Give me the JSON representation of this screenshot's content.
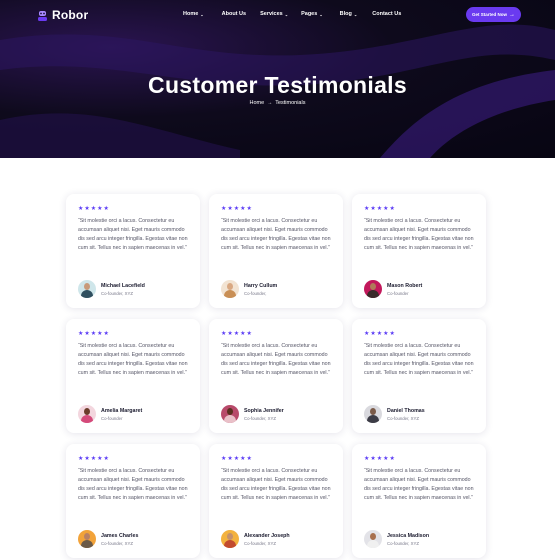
{
  "header": {
    "logo_text": "Robor",
    "nav": [
      {
        "label": "Home",
        "has_dropdown": true
      },
      {
        "label": "About Us",
        "has_dropdown": false
      },
      {
        "label": "Services",
        "has_dropdown": true
      },
      {
        "label": "Pages",
        "has_dropdown": true
      },
      {
        "label": "Blog",
        "has_dropdown": true
      },
      {
        "label": "Contact Us",
        "has_dropdown": false
      }
    ],
    "cta_label": "Get Started Now",
    "cta_icon": "arrow-right-icon"
  },
  "hero": {
    "title": "Customer Testimonials",
    "breadcrumb_home": "Home",
    "breadcrumb_current": "Testimonials"
  },
  "colors": {
    "accent": "#5b3cf5",
    "cta": "#6a3af0",
    "hero_bg": "#0e0a1c"
  },
  "testimonials": [
    {
      "stars": "★★★★★",
      "quote": "“Sit molestie orci a lacus. Consectetur eu accumsan aliquet nisi. Eget mauris commodo dis sed arcu integer fringilla. Egestas vitae non cum sit. Tellus nec in sapien maecenas in vel.”",
      "name": "Michael Lacefield",
      "role": "Co-founder, XYZ"
    },
    {
      "stars": "★★★★★",
      "quote": "“Sit molestie orci a lacus. Consectetur eu accumsan aliquet nisi. Eget mauris commodo dis sed arcu integer fringilla. Egestas vitae non cum sit. Tellus nec in sapien maecenas in vel.”",
      "name": "Harry Cullum",
      "role": "Co-founder,"
    },
    {
      "stars": "★★★★★",
      "quote": "“Sit molestie orci a lacus. Consectetur eu accumsan aliquet nisi. Eget mauris commodo dis sed arcu integer fringilla. Egestas vitae non cum sit. Tellus nec in sapien maecenas in vel.”",
      "name": "Mason Robert",
      "role": "Co-founder"
    },
    {
      "stars": "★★★★★",
      "quote": "“Sit molestie orci a lacus. Consectetur eu accumsan aliquet nisi. Eget mauris commodo dis sed arcu integer fringilla. Egestas vitae non cum sit. Tellus nec in sapien maecenas in vel.”",
      "name": "Amelia Margaret",
      "role": "Co-founder"
    },
    {
      "stars": "★★★★★",
      "quote": "“Sit molestie orci a lacus. Consectetur eu accumsan aliquet nisi. Eget mauris commodo dis sed arcu integer fringilla. Egestas vitae non cum sit. Tellus nec in sapien maecenas in vel.”",
      "name": "Sophia Jennifer",
      "role": "Co-founder, XYZ"
    },
    {
      "stars": "★★★★★",
      "quote": "“Sit molestie orci a lacus. Consectetur eu accumsan aliquet nisi. Eget mauris commodo dis sed arcu integer fringilla. Egestas vitae non cum sit. Tellus nec in sapien maecenas in vel.”",
      "name": "Daniel Thomas",
      "role": "Co-founder, XYZ"
    },
    {
      "stars": "★★★★★",
      "quote": "“Sit molestie orci a lacus. Consectetur eu accumsan aliquet nisi. Eget mauris commodo dis sed arcu integer fringilla. Egestas vitae non cum sit. Tellus nec in sapien maecenas in vel.”",
      "name": "James Charles",
      "role": "Co-founder, XYZ"
    },
    {
      "stars": "★★★★★",
      "quote": "“Sit molestie orci a lacus. Consectetur eu accumsan aliquet nisi. Eget mauris commodo dis sed arcu integer fringilla. Egestas vitae non cum sit. Tellus nec in sapien maecenas in vel.”",
      "name": "Alexander Joseph",
      "role": "Co-founder, XYZ"
    },
    {
      "stars": "★★★★★",
      "quote": "“Sit molestie orci a lacus. Consectetur eu accumsan aliquet nisi. Eget mauris commodo dis sed arcu integer fringilla. Egestas vitae non cum sit. Tellus nec in sapien maecenas in vel.”",
      "name": "Jessica Madison",
      "role": "Co-founder, XYZ"
    }
  ]
}
